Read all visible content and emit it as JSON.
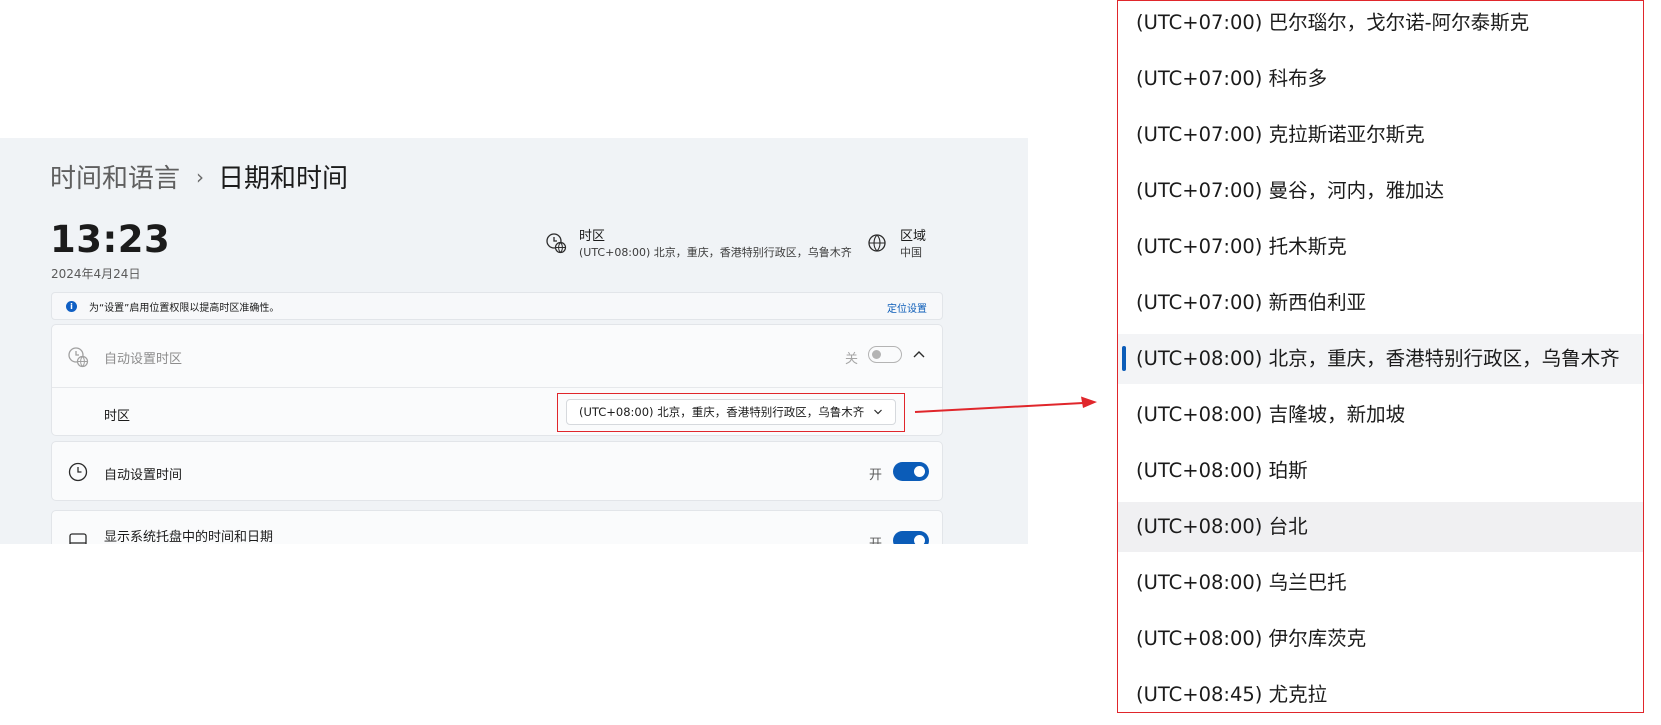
{
  "breadcrumb": {
    "parent": "时间和语言",
    "separator": "›",
    "current": "日期和时间"
  },
  "clock": {
    "time": "13:23",
    "date": "2024年4月24日"
  },
  "timezone_info": {
    "title": "时区",
    "value": "(UTC+08:00) 北京，重庆，香港特别行政区，乌鲁木齐"
  },
  "region_info": {
    "title": "区域",
    "value": "中国"
  },
  "notice": {
    "text": "为“设置”启用位置权限以提高时区准确性。",
    "link": "定位设置"
  },
  "auto_timezone": {
    "label": "自动设置时区",
    "state": "关"
  },
  "timezone_row": {
    "label": "时区",
    "selected": "(UTC+08:00) 北京，重庆，香港特别行政区，乌鲁木齐"
  },
  "auto_time": {
    "label": "自动设置时间",
    "state": "开"
  },
  "tray": {
    "label": "显示系统托盘中的时间和日期",
    "state": "开"
  },
  "timezone_list": [
    "(UTC+07:00) 巴尔瑙尔，戈尔诺-阿尔泰斯克",
    "(UTC+07:00) 科布多",
    "(UTC+07:00) 克拉斯诺亚尔斯克",
    "(UTC+07:00) 曼谷，河内，雅加达",
    "(UTC+07:00) 托木斯克",
    "(UTC+07:00) 新西伯利亚",
    "(UTC+08:00) 北京，重庆，香港特别行政区，乌鲁木齐",
    "(UTC+08:00) 吉隆坡，新加坡",
    "(UTC+08:00) 珀斯",
    "(UTC+08:00) 台北",
    "(UTC+08:00) 乌兰巴托",
    "(UTC+08:00) 伊尔库茨克",
    "(UTC+08:45) 尤克拉"
  ],
  "colors": {
    "accent": "#0b5cb8",
    "highlight_frame": "#e0262b",
    "panel_bg": "#f0f3f6"
  }
}
